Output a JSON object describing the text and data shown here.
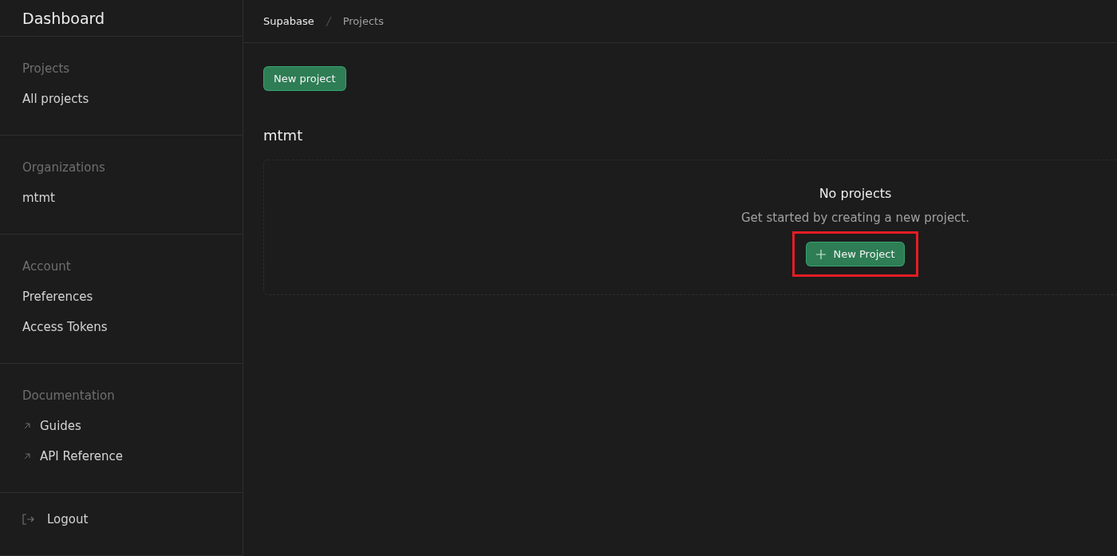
{
  "sidebar": {
    "title": "Dashboard",
    "sections": [
      {
        "heading": "Projects",
        "items": [
          {
            "label": "All projects",
            "kind": "plain"
          }
        ]
      },
      {
        "heading": "Organizations",
        "items": [
          {
            "label": "mtmt",
            "kind": "plain"
          }
        ]
      },
      {
        "heading": "Account",
        "items": [
          {
            "label": "Preferences",
            "kind": "plain"
          },
          {
            "label": "Access Tokens",
            "kind": "plain"
          }
        ]
      },
      {
        "heading": "Documentation",
        "items": [
          {
            "label": "Guides",
            "kind": "external"
          },
          {
            "label": "API Reference",
            "kind": "external"
          }
        ]
      },
      {
        "items": [
          {
            "label": "Logout",
            "kind": "logout"
          }
        ]
      }
    ]
  },
  "breadcrumb": [
    "Supabase",
    "Projects"
  ],
  "new_project_button": "New project",
  "organization": {
    "name": "mtmt",
    "empty_state": {
      "title": "No projects",
      "message": "Get started by creating a new project.",
      "button": "New Project",
      "highlighted": true
    }
  }
}
